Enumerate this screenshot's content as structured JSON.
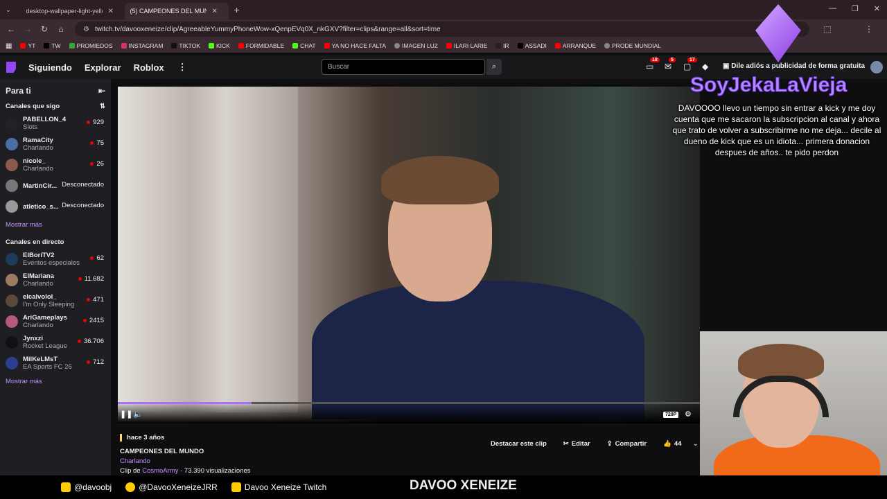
{
  "browser": {
    "tabs": [
      {
        "label": "desktop-wallpaper-light-yellow",
        "active": false
      },
      {
        "label": "(5) CAMPEONES DEL MUNI",
        "active": true
      }
    ],
    "url": "twitch.tv/davooxeneize/clip/AgreeableYummyPhoneWow-xQenpEVq0X_nkGXV?filter=clips&range=all&sort=time",
    "bookmarks": [
      "YT",
      "TW",
      "PROMIEDOS",
      "INSTAGRAM",
      "TIKTOK",
      "KICK",
      "FORMIDABLE",
      "CHAT",
      "YA NO HACE FALTA",
      "IMAGEN LUZ",
      "ILARI LARIE",
      "IR",
      "ASSADI",
      "ARRANQUE",
      "PRODE MUNDIAL"
    ]
  },
  "topnav": {
    "links": [
      "Siguiendo",
      "Explorar",
      "Roblox"
    ],
    "search_placeholder": "Buscar",
    "badges": [
      "18",
      "5",
      "17"
    ],
    "promo": "Dile adiós a publicidad de forma gratuita"
  },
  "sidebar": {
    "title": "Para ti",
    "followed_title": "Canales que sigo",
    "followed": [
      {
        "name": "PABELLON_4",
        "sub": "Slots",
        "viewers": "929",
        "color": "#222"
      },
      {
        "name": "RamaCity",
        "sub": "Charlando",
        "viewers": "75",
        "color": "#4a6fa5"
      },
      {
        "name": "nicole_",
        "sub": "Charlando",
        "viewers": "26",
        "color": "#8a5a4a"
      },
      {
        "name": "MartinCir...",
        "sub": "",
        "viewers": "Desconectado",
        "color": "#777"
      },
      {
        "name": "atletico_s...",
        "sub": "",
        "viewers": "Desconectado",
        "color": "#999"
      }
    ],
    "more1": "Mostrar más",
    "live_title": "Canales en directo",
    "live": [
      {
        "name": "ElBoriTV2",
        "sub": "Eventos especiales",
        "viewers": "62",
        "color": "#1e3a5c"
      },
      {
        "name": "ElMariana",
        "sub": "Charlando",
        "viewers": "11.682",
        "color": "#9c7b63"
      },
      {
        "name": "elcalvolol_",
        "sub": "I'm Only Sleeping",
        "viewers": "471",
        "color": "#5a4a3a"
      },
      {
        "name": "AriGameplays",
        "sub": "Charlando",
        "viewers": "2415",
        "color": "#b55a7a"
      },
      {
        "name": "Jynxzi",
        "sub": "Rocket League",
        "viewers": "36.706",
        "color": "#111"
      },
      {
        "name": "MiIKeLMsT",
        "sub": "EA Sports FC 26",
        "viewers": "712",
        "color": "#2a3f8f"
      }
    ],
    "more2": "Mostrar más"
  },
  "player": {
    "progress": 0.23,
    "quality": "720P"
  },
  "clip": {
    "ago": "hace 3 años",
    "title": "CAMPEONES DEL MUNDO",
    "category": "Charlando",
    "clip_prefix": "Clip de",
    "clipper": "CosmoArmy",
    "views": " · 73.390 visualizaciones",
    "actions": {
      "feature": "Destacar este clip",
      "edit": "Editar",
      "share": "Compartir",
      "likes": "44"
    }
  },
  "overlay": {
    "donor": "SoyJekaLaVieja",
    "message": "DAVOOOO llevo un tiempo sin entrar a kick y me doy cuenta que me sacaron la subscripcion al canal y ahora que trato de volver a subscribirme no me deja... decile al dueno de kick que es un idiota... primera donacion despues de años.. te pido perdon"
  },
  "footer": {
    "instagram": "@davoobj",
    "twitter": "@DavooXeneizeJRR",
    "youtube": "Davoo Xeneize Twitch",
    "brand": "DAVOO XENEIZE"
  }
}
